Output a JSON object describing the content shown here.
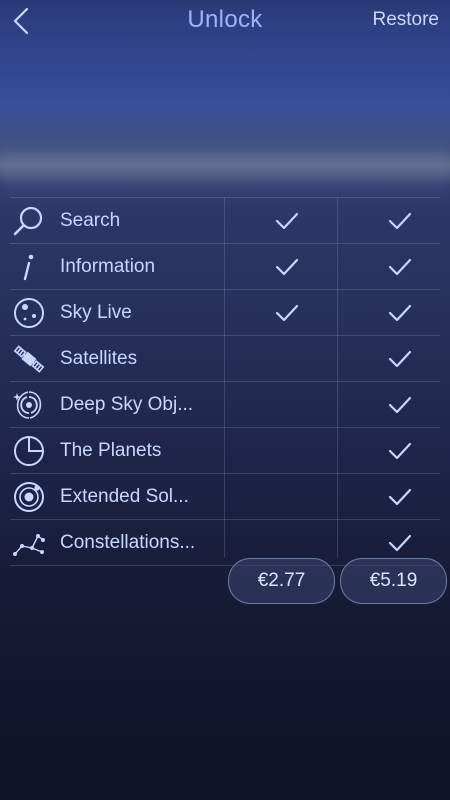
{
  "header": {
    "title": "Unlock",
    "restore_label": "Restore"
  },
  "features": [
    {
      "label": "Search",
      "icon": "search-icon",
      "tier1": true,
      "tier2": true
    },
    {
      "label": "Information",
      "icon": "info-icon",
      "tier1": true,
      "tier2": true
    },
    {
      "label": "Sky Live",
      "icon": "sky-live-icon",
      "tier1": true,
      "tier2": true
    },
    {
      "label": "Satellites",
      "icon": "satellite-icon",
      "tier1": false,
      "tier2": true
    },
    {
      "label": "Deep Sky Obj...",
      "icon": "galaxy-icon",
      "tier1": false,
      "tier2": true
    },
    {
      "label": "The Planets",
      "icon": "planets-icon",
      "tier1": false,
      "tier2": true
    },
    {
      "label": "Extended Sol...",
      "icon": "orbit-icon",
      "tier1": false,
      "tier2": true
    },
    {
      "label": "Constellations...",
      "icon": "constellation-icon",
      "tier1": false,
      "tier2": true
    }
  ],
  "prices": {
    "tier1": "€2.77",
    "tier2": "€5.19"
  },
  "colors": {
    "accent": "#9fb2ff",
    "text": "#c9d6ff"
  }
}
